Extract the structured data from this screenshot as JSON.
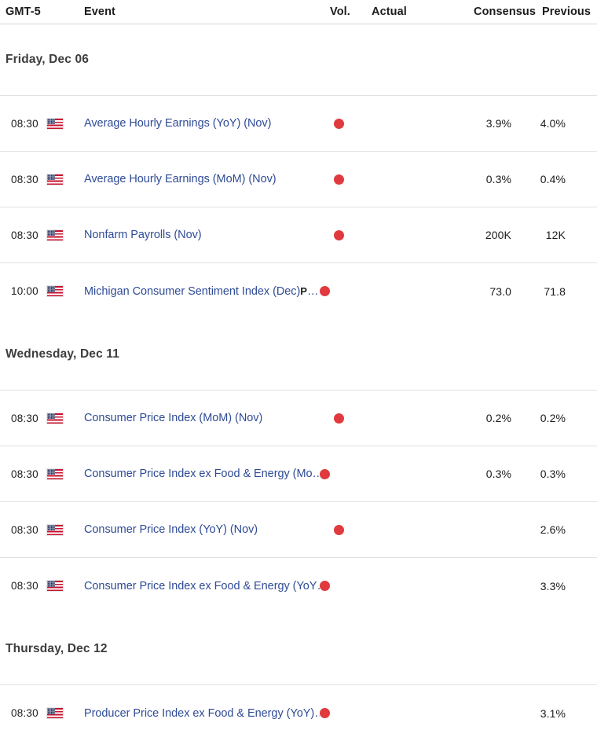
{
  "header": {
    "timezone_label": "GMT-5",
    "event_label": "Event",
    "vol_label": "Vol.",
    "actual_label": "Actual",
    "consensus_label": "Consensus",
    "previous_label": "Previous"
  },
  "colors": {
    "link": "#2f4b95",
    "volatility_high": "#e03a3e",
    "date_heading": "#3d3d3d",
    "row_divider": "#dfe1e3"
  },
  "icons": {
    "flag": "us-flag-icon",
    "volatility": "volatility-high-dot-icon"
  },
  "groups": [
    {
      "date_label": "Friday, Dec 06",
      "rows": [
        {
          "time": "08:30",
          "country": "United States",
          "event": "Average Hourly Earnings (YoY) (Nov)",
          "badge": "",
          "truncated": false,
          "volatility": "high",
          "actual": "",
          "consensus": "3.9%",
          "previous": "4.0%"
        },
        {
          "time": "08:30",
          "country": "United States",
          "event": "Average Hourly Earnings (MoM) (Nov)",
          "badge": "",
          "truncated": false,
          "volatility": "high",
          "actual": "",
          "consensus": "0.3%",
          "previous": "0.4%"
        },
        {
          "time": "08:30",
          "country": "United States",
          "event": "Nonfarm Payrolls (Nov)",
          "badge": "",
          "truncated": false,
          "volatility": "high",
          "actual": "",
          "consensus": "200K",
          "previous": "12K"
        },
        {
          "time": "10:00",
          "country": "United States",
          "event": "Michigan Consumer Sentiment Index (Dec)",
          "badge": "P",
          "truncated": true,
          "volatility": "high",
          "actual": "",
          "consensus": "73.0",
          "previous": "71.8"
        }
      ]
    },
    {
      "date_label": "Wednesday, Dec 11",
      "rows": [
        {
          "time": "08:30",
          "country": "United States",
          "event": "Consumer Price Index (MoM) (Nov)",
          "badge": "",
          "truncated": false,
          "volatility": "high",
          "actual": "",
          "consensus": "0.2%",
          "previous": "0.2%"
        },
        {
          "time": "08:30",
          "country": "United States",
          "event": "Consumer Price Index ex Food & Energy (Mo",
          "badge": "",
          "truncated": true,
          "volatility": "high",
          "actual": "",
          "consensus": "0.3%",
          "previous": "0.3%"
        },
        {
          "time": "08:30",
          "country": "United States",
          "event": "Consumer Price Index (YoY) (Nov)",
          "badge": "",
          "truncated": false,
          "volatility": "high",
          "actual": "",
          "consensus": "",
          "previous": "2.6%"
        },
        {
          "time": "08:30",
          "country": "United States",
          "event": "Consumer Price Index ex Food & Energy (YoY",
          "badge": "",
          "truncated": true,
          "volatility": "high",
          "actual": "",
          "consensus": "",
          "previous": "3.3%"
        }
      ]
    },
    {
      "date_label": "Thursday, Dec 12",
      "rows": [
        {
          "time": "08:30",
          "country": "United States",
          "event": "Producer Price Index ex Food & Energy (YoY)",
          "badge": "",
          "truncated": true,
          "volatility": "high",
          "actual": "",
          "consensus": "",
          "previous": "3.1%"
        }
      ]
    }
  ]
}
